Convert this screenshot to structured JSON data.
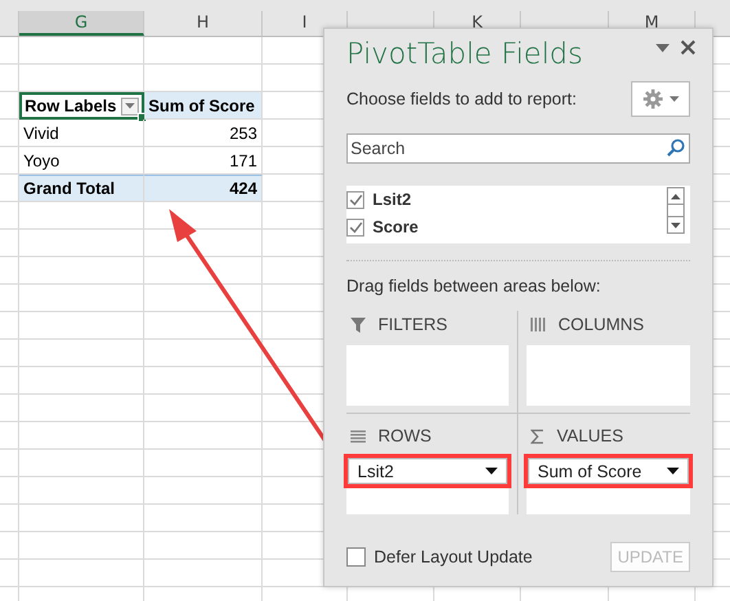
{
  "sheet": {
    "columns": [
      {
        "selected": false
      },
      {
        "label": "G",
        "selected": true
      },
      {
        "label": "H",
        "selected": false
      },
      {
        "label": "I",
        "selected": false
      },
      {
        "selected": false
      },
      {
        "label": "K",
        "selected": false
      },
      {
        "selected": false
      },
      {
        "label": "M",
        "selected": false
      }
    ],
    "pivot": {
      "row_labels": "Row Labels",
      "value_header": "Sum of Score",
      "rows": [
        {
          "label": "Vivid",
          "value": "253"
        },
        {
          "label": "Yoyo",
          "value": "171"
        }
      ],
      "grand_total": {
        "label": "Grand Total",
        "value": "424"
      }
    }
  },
  "panel": {
    "title": "PivotTable Fields",
    "subtitle": "Choose fields to add to report:",
    "search": {
      "placeholder": "Search"
    },
    "fields": [
      {
        "name": "Lsit2",
        "checked": true
      },
      {
        "name": "Score",
        "checked": true
      }
    ],
    "drag_hint": "Drag fields between areas below:",
    "areas": [
      {
        "kind": "filters",
        "label": "FILTERS"
      },
      {
        "kind": "columns",
        "label": "COLUMNS"
      },
      {
        "kind": "rows",
        "label": "ROWS",
        "items": [
          {
            "name": "Lsit2",
            "highlighted": true
          }
        ]
      },
      {
        "kind": "values",
        "label": "VALUES",
        "items": [
          {
            "name": "Sum of Score",
            "highlighted": true
          }
        ]
      }
    ],
    "defer": {
      "label": "Defer Layout Update",
      "checked": false
    },
    "update_button": {
      "label": "UPDATE",
      "disabled": true
    }
  }
}
